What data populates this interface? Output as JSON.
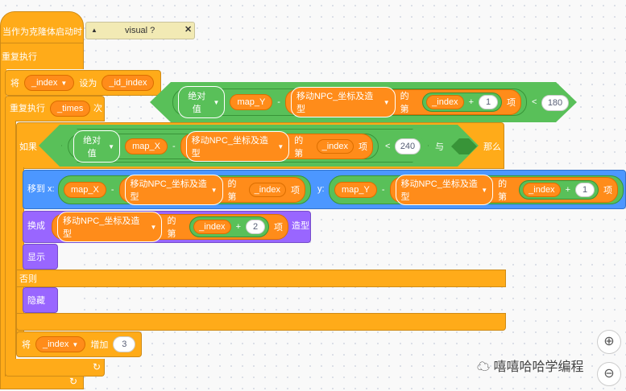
{
  "hat_label": "当作为克隆体启动时",
  "repeat_forever_label": "重复执行",
  "set_label": "将",
  "set_var": "_index",
  "set_to_label": "设为",
  "set_value": "_id_index",
  "repeat_label": "重复执行",
  "repeat_var": "_times",
  "repeat_times_label": "次",
  "if_label": "如果",
  "then_label": "那么",
  "else_label": "否则",
  "and_label": "与",
  "abs_label": "绝对值",
  "map_y": "map_Y",
  "map_x": "map_X",
  "minus": "-",
  "plus": "+",
  "list_name": "移动NPC_坐标及造型",
  "item_of_label": "的第",
  "item_suffix": "项",
  "lt": "<",
  "cond1_value": "180",
  "cond2_value": "240",
  "one": "1",
  "two": "2",
  "goto_label_x": "移到 x:",
  "goto_label_y": "y:",
  "switch_label": "换成",
  "costume_label": "造型",
  "show_label": "显示",
  "hide_label": "隐藏",
  "change_label": "将",
  "change_var": "_index",
  "change_by_label": "增加",
  "change_value": "3",
  "monitor_label": "visual ?",
  "watermark": "嘻嘻哈哈学编程"
}
